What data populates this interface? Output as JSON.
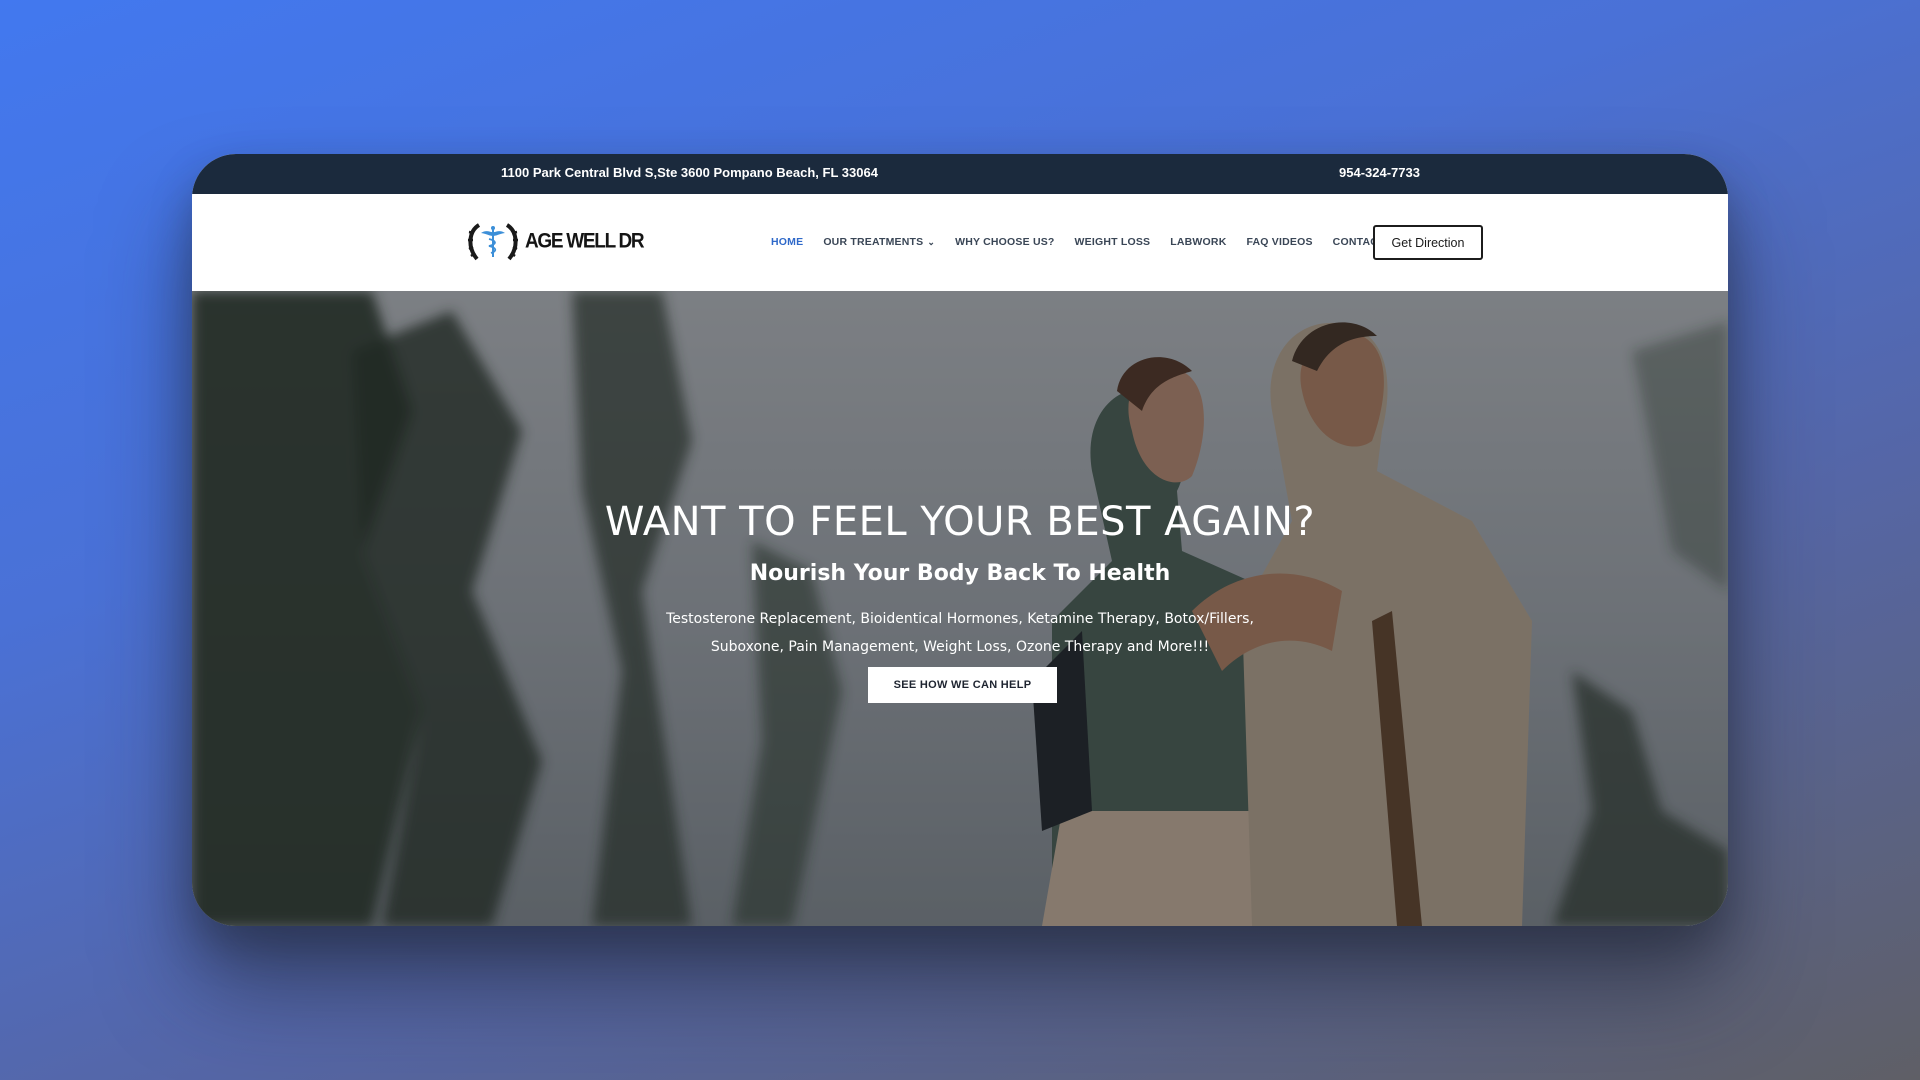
{
  "topbar": {
    "address": "1100 Park Central Blvd S,Ste 3600 Pompano Beach, FL 33064",
    "phone": "954-324-7733"
  },
  "brand": {
    "name": "AGE WELL DR",
    "logo_icon": "caduceus-laurel-icon"
  },
  "nav": {
    "items": [
      {
        "label": "HOME",
        "active": true
      },
      {
        "label": "OUR TREATMENTS",
        "has_dropdown": true
      },
      {
        "label": "WHY CHOOSE US?"
      },
      {
        "label": "WEIGHT LOSS"
      },
      {
        "label": "LABWORK"
      },
      {
        "label": "FAQ VIDEOS"
      },
      {
        "label": "CONTACT"
      }
    ],
    "cta_label": "Get Direction"
  },
  "hero": {
    "title": "WANT TO FEEL YOUR BEST AGAIN?",
    "subtitle": "Nourish Your Body Back To Health",
    "description_line1": "Testosterone Replacement, Bioidentical Hormones, Ketamine Therapy, Botox/Fillers,",
    "description_line2": "Suboxone, Pain Management, Weight Loss, Ozone Therapy and More!!!",
    "button_label": "SEE HOW WE CAN HELP"
  },
  "colors": {
    "topbar_bg": "#1b2a3d",
    "active_nav": "#2f69c9",
    "nav_text": "#3a4656"
  }
}
